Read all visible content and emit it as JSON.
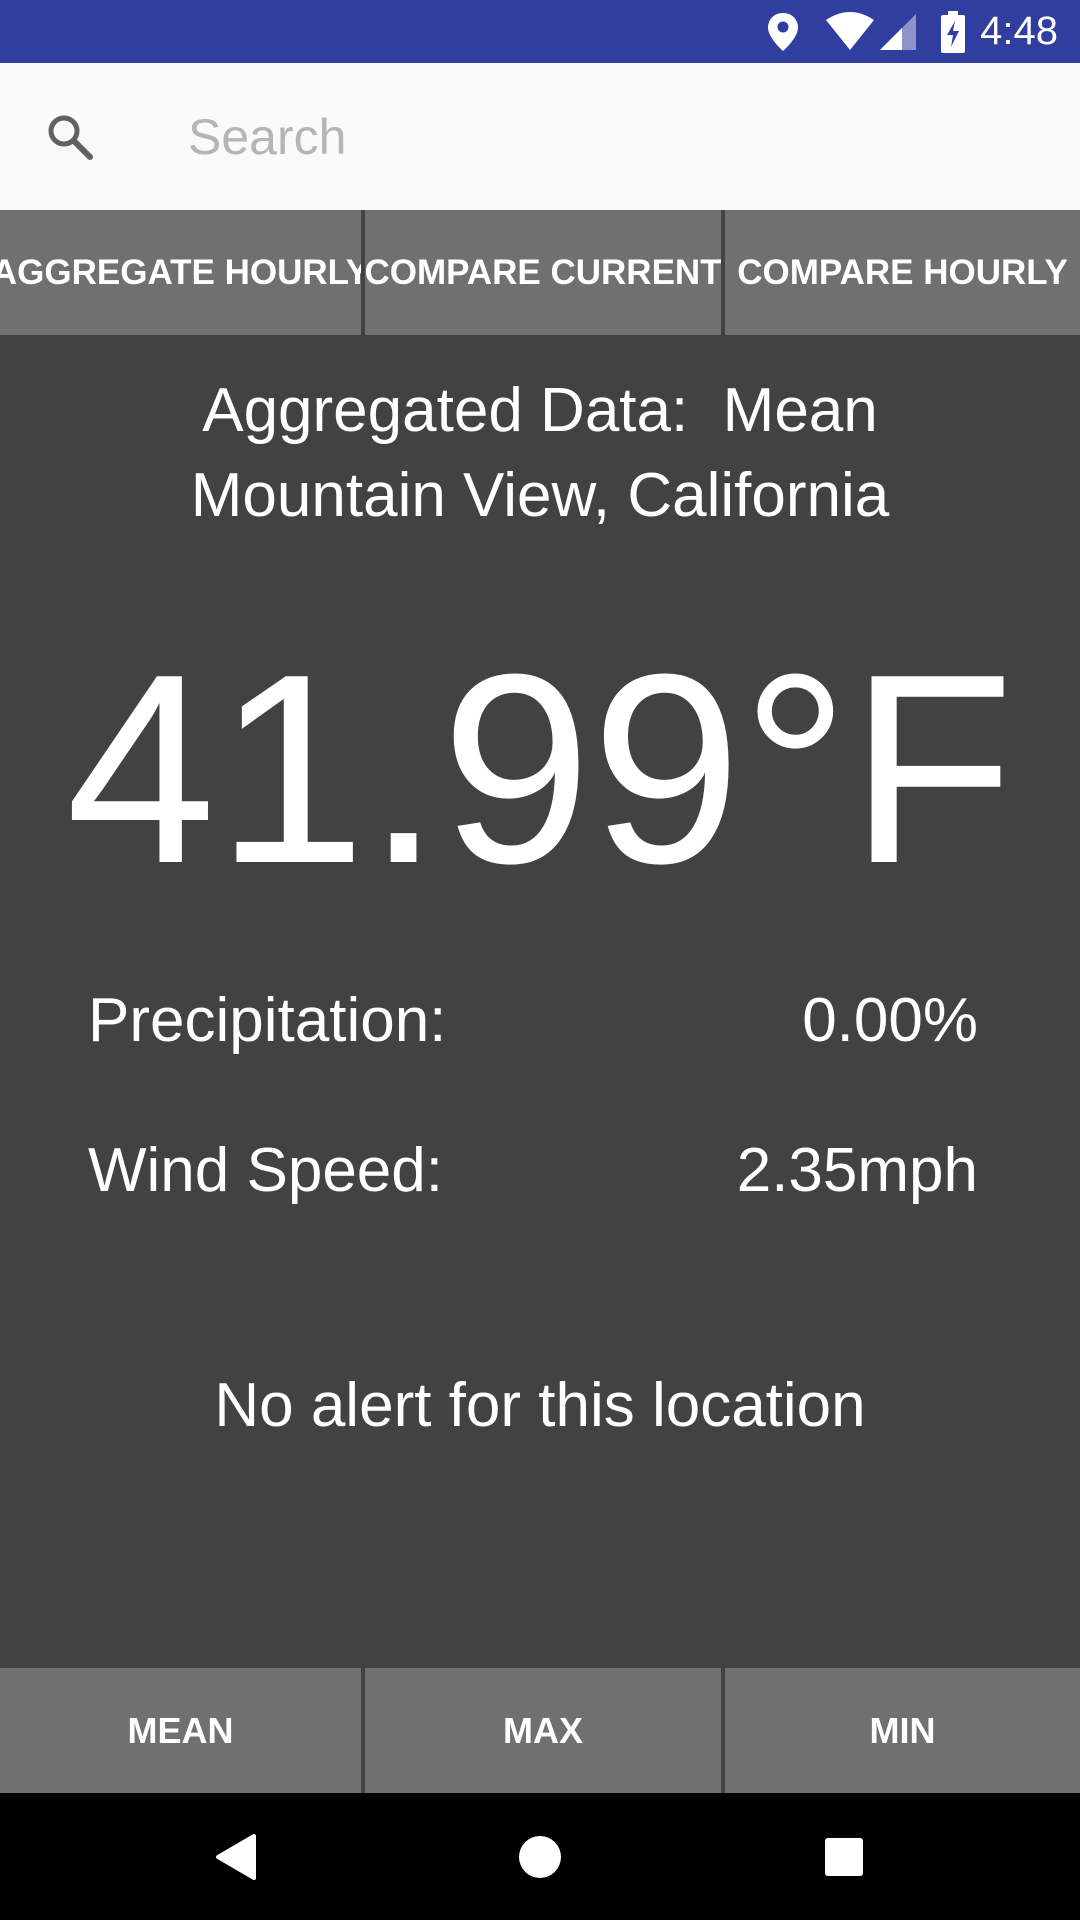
{
  "status_bar": {
    "time": "4:48",
    "icons": [
      "location-icon",
      "wifi-icon",
      "signal-icon",
      "battery-charging-icon"
    ],
    "background_color": "#303F9F"
  },
  "search": {
    "placeholder": "Search",
    "value": "",
    "icon": "search-icon"
  },
  "top_tabs": [
    {
      "label": "AGGREGATE HOURLY"
    },
    {
      "label": "COMPARE CURRENT"
    },
    {
      "label": "COMPARE HOURLY"
    }
  ],
  "main": {
    "title_line1": "Aggregated Data:  Mean",
    "title_line2": "Mountain View, California",
    "temperature": "41.99°F",
    "precipitation_label": "Precipitation:",
    "precipitation_value": "0.00%",
    "wind_label": "Wind Speed:",
    "wind_value": "2.35mph",
    "alert": "No alert for this location",
    "background_color": "#424242"
  },
  "bottom_tabs": [
    {
      "label": "MEAN"
    },
    {
      "label": "MAX"
    },
    {
      "label": "MIN"
    }
  ],
  "nav_bar": {
    "buttons": [
      "back-icon",
      "home-icon",
      "recents-icon"
    ]
  },
  "colors": {
    "button_gray": "#707070",
    "text_white": "#FFFFFF"
  }
}
